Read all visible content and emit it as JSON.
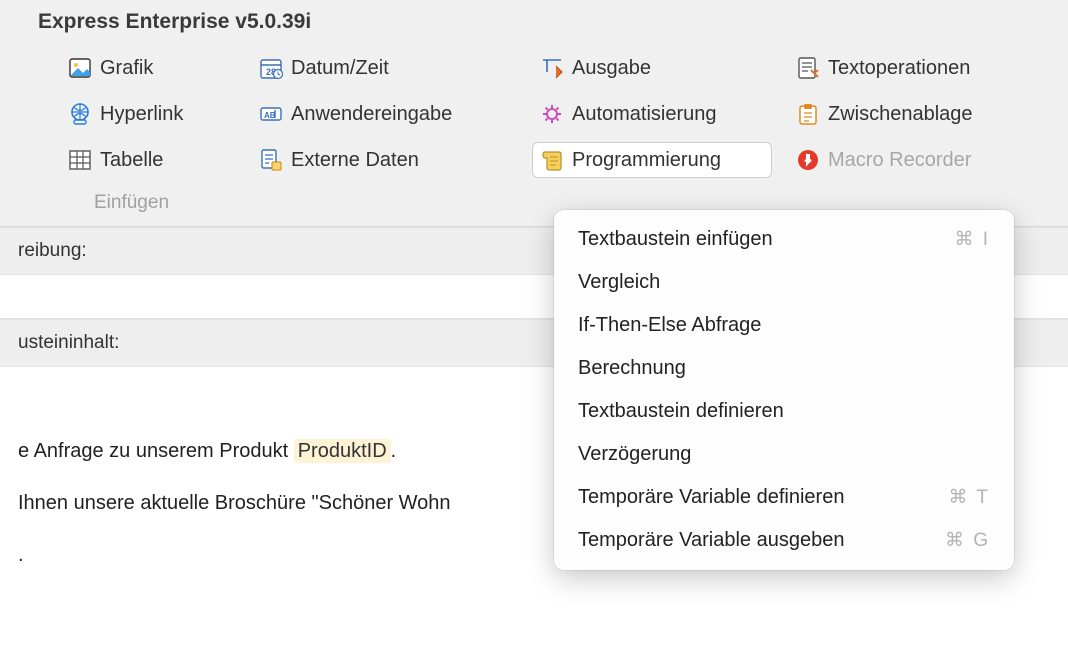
{
  "window": {
    "title": "Express Enterprise v5.0.39i"
  },
  "ribbon": {
    "group_label": "Einfügen",
    "cols": [
      [
        {
          "icon": "image-icon",
          "label": "Grafik"
        },
        {
          "icon": "hyperlink-icon",
          "label": "Hyperlink"
        },
        {
          "icon": "table-icon",
          "label": "Tabelle"
        }
      ],
      [
        {
          "icon": "calendar-icon",
          "label": "Datum/Zeit"
        },
        {
          "icon": "userinput-icon",
          "label": "Anwendereingabe"
        },
        {
          "icon": "externaldata-icon",
          "label": "Externe Daten"
        }
      ],
      [
        {
          "icon": "output-icon",
          "label": "Ausgabe"
        },
        {
          "icon": "automation-icon",
          "label": "Automatisierung"
        },
        {
          "icon": "scroll-icon",
          "label": "Programmierung",
          "selected": true
        }
      ],
      [
        {
          "icon": "textops-icon",
          "label": "Textoperationen"
        },
        {
          "icon": "clipboard-icon",
          "label": "Zwischenablage"
        },
        {
          "icon": "record-icon",
          "label": "Macro Recorder",
          "disabled": true
        }
      ]
    ]
  },
  "sections": {
    "description_label": "reibung:",
    "content_label": "usteininhalt:"
  },
  "content": {
    "line1_pre": "e Anfrage zu unserem Produkt ",
    "line1_token": "ProduktID",
    "line1_post": ".",
    "line2": " Ihnen unsere aktuelle Broschüre \"Schöner Wohn",
    "line3": "."
  },
  "dropdown": {
    "items": [
      {
        "label": "Textbaustein einfügen",
        "shortcut": "⌘ I"
      },
      {
        "label": "Vergleich",
        "shortcut": ""
      },
      {
        "label": "If-Then-Else Abfrage",
        "shortcut": ""
      },
      {
        "label": "Berechnung",
        "shortcut": ""
      },
      {
        "label": "Textbaustein definieren",
        "shortcut": ""
      },
      {
        "label": "Verzögerung",
        "shortcut": ""
      },
      {
        "label": "Temporäre Variable definieren",
        "shortcut": "⌘ T"
      },
      {
        "label": "Temporäre Variable ausgeben",
        "shortcut": "⌘ G"
      }
    ]
  }
}
